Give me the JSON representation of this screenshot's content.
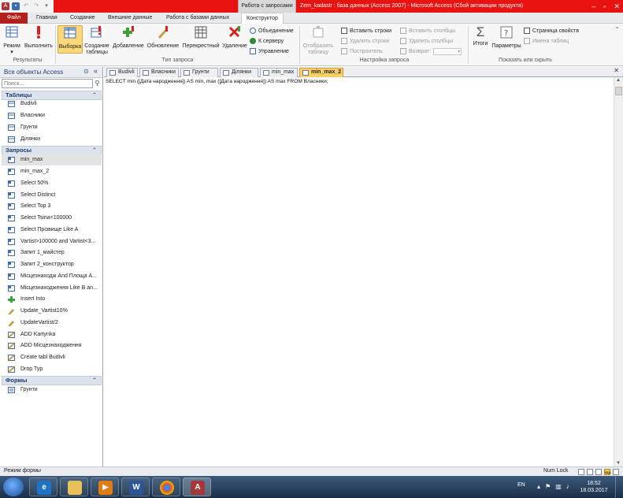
{
  "window": {
    "title": "Zem_kadastr : база данных (Access 2007)  -  Microsoft Access (Сбой активации продукта)",
    "context_tools_label": "Работа с запросами"
  },
  "ribbon_tabs": [
    "Файл",
    "Главная",
    "Создание",
    "Внешние данные",
    "Работа с базами данных",
    "Конструктор"
  ],
  "ribbon": {
    "results": {
      "label": "Результаты",
      "view": "Режим",
      "run": "Выполнить"
    },
    "query_type": {
      "label": "Тип запроса",
      "select": "Выборка",
      "make_table": "Создание таблицы",
      "append": "Добавление",
      "update": "Обновление",
      "crosstab": "Перекрестный",
      "delete": "Удаление",
      "union": "Объединение",
      "pass_through": "К серверу",
      "data_definition": "Управление"
    },
    "query_setup": {
      "label": "Настройка запроса",
      "show_table": "Отобразить таблицу",
      "insert_rows": "Вставить строки",
      "delete_rows": "Удалить строки",
      "builder": "Построитель",
      "insert_columns": "Вставить столбцы",
      "delete_columns": "Удалить столбцы",
      "return": "Возврат:"
    },
    "show_hide": {
      "label": "Показать или скрыть",
      "totals": "Итоги",
      "parameters": "Параметры",
      "property_sheet": "Страница свойств",
      "table_names": "Имена таблиц"
    }
  },
  "nav": {
    "title": "Все объекты Access",
    "search_placeholder": "Поиск...",
    "sections": [
      {
        "name": "Таблицы",
        "items": [
          "Budivli",
          "Власники",
          "Грунти",
          "Ділянки"
        ]
      },
      {
        "name": "Запросы",
        "items": [
          "min_max",
          "min_max_2",
          "Select 50%",
          "Select Distinct",
          "Select Top 3",
          "Select Tsina<100000",
          "Select Прізвище Like A",
          "Vartist>100000 and Vartist<3...",
          "Запит 1_майстер",
          "Запит 2_конструктор",
          "Місцезнаходж And Площа A...",
          "Місцезнаходження Like B an...",
          "Insert Into",
          "Update_Vartist10%",
          "UpdateVartist/2",
          "ADD Kartynka",
          "ADD Місцезнаходження",
          "Create tabl Budivli",
          "Drop Typ"
        ]
      },
      {
        "name": "Формы",
        "items": [
          "Грунти"
        ]
      }
    ]
  },
  "doc_tabs": [
    "Budivli",
    "Власники",
    "Грунти",
    "Ділянки",
    "min_max",
    "min_max_2"
  ],
  "sql_text": "SELECT min ([Дата народження]) AS min, max ([Дата народження]) AS max FROM Власники;",
  "status": {
    "left": "Режим формы",
    "numlock": "Num Lock",
    "sql_view": "SQL"
  },
  "taskbar": {
    "lang": "EN",
    "time": "18:52",
    "date": "18.03.2017"
  },
  "colors": {
    "titlebar": "#e81310",
    "file_tab": "#b3201c",
    "active_doc_tab": "#fbcf68",
    "active_button": "#fbd879"
  }
}
